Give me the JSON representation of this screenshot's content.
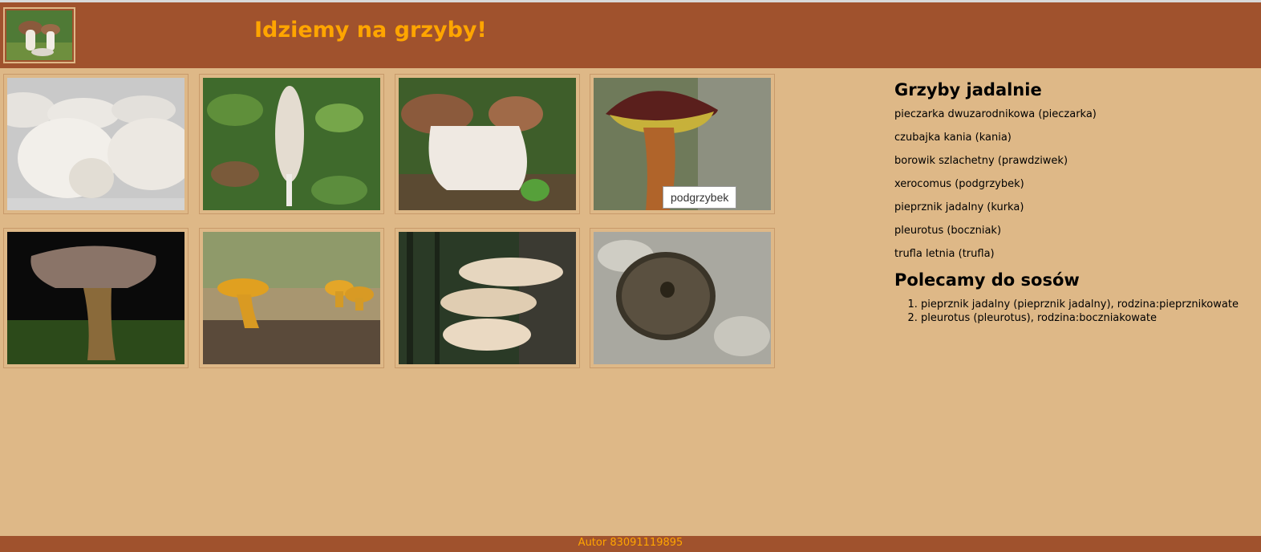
{
  "header": {
    "title": "Idziemy na grzyby!",
    "logo_icon": "mushroom-logo-icon"
  },
  "gallery": {
    "images": [
      {
        "alt": "pieczarka"
      },
      {
        "alt": "kania"
      },
      {
        "alt": "prawdziwek"
      },
      {
        "alt": "podgrzybek"
      },
      {
        "alt": "kurka"
      },
      {
        "alt": "kurka"
      },
      {
        "alt": "boczniak"
      },
      {
        "alt": "trufla"
      }
    ],
    "tooltip": "podgrzybek"
  },
  "edible": {
    "heading": "Grzyby jadalnie",
    "items": [
      "pieczarka dwuzarodnikowa (pieczarka)",
      "czubajka kania (kania)",
      "borowik szlachetny (prawdziwek)",
      "xerocomus (podgrzybek)",
      "pieprznik jadalny (kurka)",
      "pleurotus (boczniak)",
      "trufla letnia (trufla)"
    ]
  },
  "sauces": {
    "heading": "Polecamy do sosów",
    "items": [
      "pieprznik jadalny (pieprznik jadalny), rodzina:pieprznikowate",
      "pleurotus (pleurotus), rodzina:boczniakowate"
    ]
  },
  "footer": {
    "text": "Autor 83091119895"
  },
  "colors": {
    "header_bg": "#A0522D",
    "page_bg": "#DEB887",
    "accent": "#FFA500"
  }
}
